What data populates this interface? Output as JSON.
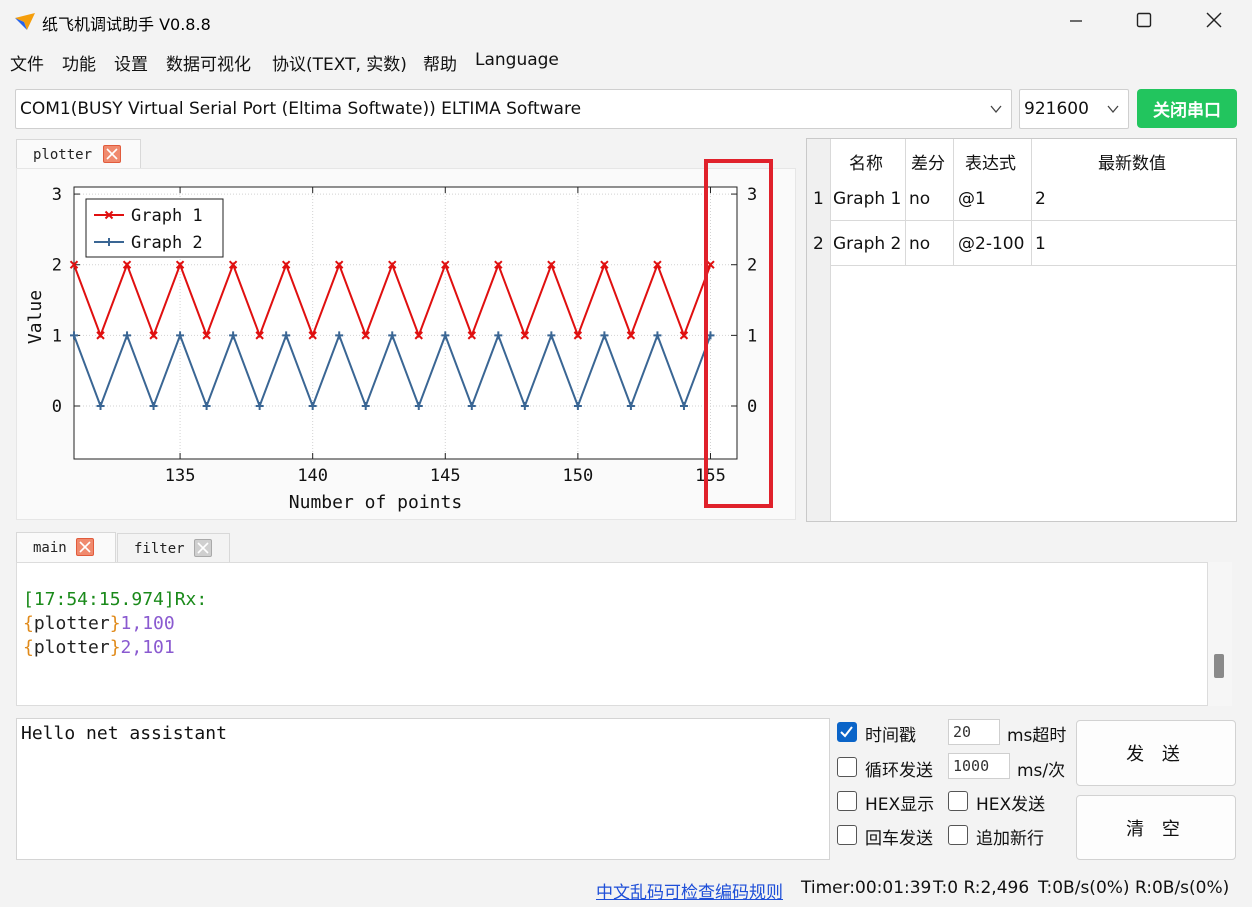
{
  "window": {
    "title": "纸飞机调试助手 V0.8.8",
    "icons": [
      "paper-plane-icon",
      "minimize-icon",
      "maximize-icon",
      "close-icon"
    ]
  },
  "menu": [
    "文件",
    "功能",
    "设置",
    "数据可视化",
    "协议(TEXT, 实数)",
    "帮助",
    "Language"
  ],
  "port": {
    "name": "COM1(BUSY  Virtual Serial Port (Eltima Softwate)) ELTIMA Software",
    "baud": "921600",
    "close_button": "关闭串口"
  },
  "plot_tabs": [
    {
      "label": "plotter",
      "closable": true
    }
  ],
  "chart_data": {
    "type": "line",
    "xlabel": "Number of points",
    "ylabel": "Value",
    "xlim": [
      131,
      156
    ],
    "ylim": [
      -0.75,
      3.1
    ],
    "xticks": [
      135,
      140,
      145,
      150,
      155
    ],
    "yticks": [
      0,
      1,
      2,
      3
    ],
    "legend_position": "top-left",
    "grid": true,
    "series": [
      {
        "name": "Graph 1",
        "color": "#e01010",
        "marker": "x",
        "x": [
          131,
          132,
          133,
          134,
          135,
          136,
          137,
          138,
          139,
          140,
          141,
          142,
          143,
          144,
          145,
          146,
          147,
          148,
          149,
          150,
          151,
          152,
          153,
          154,
          155
        ],
        "y": [
          2,
          1,
          2,
          1,
          2,
          1,
          2,
          1,
          2,
          1,
          2,
          1,
          2,
          1,
          2,
          1,
          2,
          1,
          2,
          1,
          2,
          1,
          2,
          1,
          2
        ]
      },
      {
        "name": "Graph 2",
        "color": "#3a6694",
        "marker": "+",
        "x": [
          131,
          132,
          133,
          134,
          135,
          136,
          137,
          138,
          139,
          140,
          141,
          142,
          143,
          144,
          145,
          146,
          147,
          148,
          149,
          150,
          151,
          152,
          153,
          154,
          155
        ],
        "y": [
          1,
          0,
          1,
          0,
          1,
          0,
          1,
          0,
          1,
          0,
          1,
          0,
          1,
          0,
          1,
          0,
          1,
          0,
          1,
          0,
          1,
          0,
          1,
          0,
          1
        ]
      }
    ]
  },
  "annotation_color": "#e0212b",
  "table": {
    "headers": [
      "名称",
      "差分",
      "表达式",
      "最新数值"
    ],
    "rows": [
      {
        "index": "1",
        "name": "Graph 1",
        "diff": "no",
        "expr": "@1",
        "value": "2"
      },
      {
        "index": "2",
        "name": "Graph 2",
        "diff": "no",
        "expr": "@2-100",
        "value": "1"
      }
    ]
  },
  "log_tabs": [
    {
      "label": "main",
      "closable": true
    },
    {
      "label": "filter",
      "closable": false
    }
  ],
  "log": {
    "timestamp": "[17:54:15.974]Rx:",
    "lines": [
      {
        "open": "{",
        "key": "plotter",
        "close": "}",
        "value": "1,100"
      },
      {
        "open": "{",
        "key": "plotter",
        "close": "}",
        "value": "2,101"
      }
    ]
  },
  "input_text": "Hello net assistant",
  "options": {
    "timestamp_label": "时间戳",
    "timestamp_checked": true,
    "timeout_value": "20",
    "timeout_unit": "ms超时",
    "loop_label": "循环发送",
    "loop_checked": false,
    "loop_value": "1000",
    "loop_unit": "ms/次",
    "hex_show": "HEX显示",
    "hex_send": "HEX发送",
    "cr_send": "回车发送",
    "append_newline": "追加新行"
  },
  "buttons": {
    "send": "发 送",
    "clear": "清 空"
  },
  "status": {
    "link": "中文乱码可检查编码规则",
    "timer": "Timer:00:01:39",
    "tx_rx": "T:0 R:2,496",
    "rates": "T:0B/s(0%) R:0B/s(0%)"
  }
}
